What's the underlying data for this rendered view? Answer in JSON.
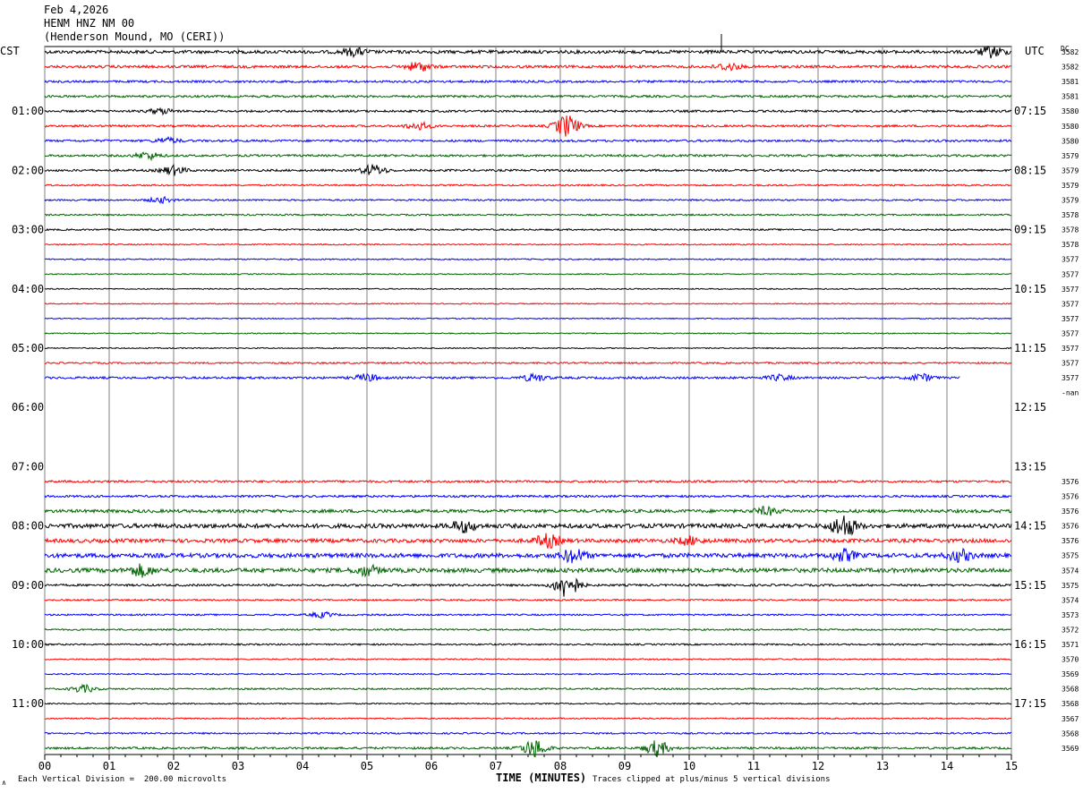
{
  "header": {
    "date": "Feb 4,2026",
    "station": "HENM HNZ NM 00",
    "location": "(Henderson Mound, MO (CERI))"
  },
  "colors": [
    "#000000",
    "#ff0000",
    "#0000ff",
    "#006400"
  ],
  "footer": {
    "scale_note": "Each Vertical Division =  200.00 microvolts",
    "clip_note": "Traces clipped at plus/minus 5 vertical divisions",
    "corner_mark": "∧"
  },
  "chart_data": {
    "type": "line",
    "title": "",
    "xlabel": "TIME (MINUTES)",
    "xlim": [
      0,
      15
    ],
    "x_ticks": [
      "00",
      "01",
      "02",
      "03",
      "04",
      "05",
      "06",
      "07",
      "08",
      "09",
      "10",
      "11",
      "12",
      "13",
      "14",
      "15"
    ],
    "left_axis_label": "CST",
    "right_axis_label": "UTC",
    "dc_label": "DC",
    "left_hour_labels": [
      "01:00",
      "02:00",
      "03:00",
      "04:00",
      "05:00",
      "06:00",
      "07:00",
      "08:00",
      "09:00",
      "10:00",
      "11:00"
    ],
    "right_hour_labels": [
      "07:15",
      "08:15",
      "09:15",
      "10:15",
      "11:15",
      "12:15",
      "13:15",
      "14:15",
      "15:15",
      "16:15",
      "17:15"
    ],
    "gap_label": "-nan",
    "rows": [
      {
        "dc": "3582",
        "amp": 3,
        "events": [
          [
            4.8,
            4
          ],
          [
            14.7,
            6
          ]
        ]
      },
      {
        "dc": "3582",
        "amp": 2.5,
        "events": [
          [
            5.8,
            5
          ],
          [
            10.6,
            4
          ]
        ]
      },
      {
        "dc": "3581",
        "amp": 2,
        "events": []
      },
      {
        "dc": "3581",
        "amp": 2,
        "events": []
      },
      {
        "dc": "3580",
        "amp": 2,
        "events": [
          [
            1.8,
            3
          ]
        ]
      },
      {
        "dc": "3580",
        "amp": 2,
        "events": [
          [
            5.8,
            4
          ],
          [
            8.1,
            12
          ]
        ]
      },
      {
        "dc": "3580",
        "amp": 2,
        "events": [
          [
            1.9,
            3
          ]
        ]
      },
      {
        "dc": "3579",
        "amp": 2,
        "events": [
          [
            1.6,
            4
          ]
        ]
      },
      {
        "dc": "3579",
        "amp": 2,
        "events": [
          [
            2.0,
            5
          ],
          [
            5.1,
            6
          ]
        ]
      },
      {
        "dc": "3579",
        "amp": 1.5,
        "events": []
      },
      {
        "dc": "3579",
        "amp": 1.5,
        "events": [
          [
            1.8,
            3
          ]
        ]
      },
      {
        "dc": "3578",
        "amp": 1.5,
        "events": []
      },
      {
        "dc": "3578",
        "amp": 1.5,
        "events": []
      },
      {
        "dc": "3578",
        "amp": 1.2,
        "events": []
      },
      {
        "dc": "3577",
        "amp": 1.2,
        "events": []
      },
      {
        "dc": "3577",
        "amp": 1,
        "events": []
      },
      {
        "dc": "3577",
        "amp": 1,
        "events": []
      },
      {
        "dc": "3577",
        "amp": 1,
        "events": []
      },
      {
        "dc": "3577",
        "amp": 1,
        "events": []
      },
      {
        "dc": "3577",
        "amp": 1,
        "events": []
      },
      {
        "dc": "3577",
        "amp": 1,
        "events": []
      },
      {
        "dc": "3577",
        "amp": 1.5,
        "events": []
      },
      {
        "dc": "3577",
        "amp": 2,
        "events": [
          [
            5.0,
            4
          ],
          [
            7.6,
            4
          ],
          [
            11.4,
            3
          ],
          [
            13.6,
            4
          ]
        ],
        "end": 14.2
      },
      {
        "dc": "",
        "amp": 0,
        "events": [],
        "gap": true
      },
      {
        "dc": "",
        "amp": 0,
        "events": [],
        "gap": true
      },
      {
        "dc": "",
        "amp": 0,
        "events": [],
        "gap": true
      },
      {
        "dc": "",
        "amp": 0,
        "events": [],
        "gap": true
      },
      {
        "dc": "",
        "amp": 0,
        "events": [],
        "gap": true
      },
      {
        "dc": "",
        "amp": 0,
        "events": [],
        "gap": true
      },
      {
        "dc": "3576",
        "amp": 2,
        "events": []
      },
      {
        "dc": "3576",
        "amp": 2,
        "events": []
      },
      {
        "dc": "3576",
        "amp": 3,
        "events": [
          [
            11.2,
            4
          ]
        ]
      },
      {
        "dc": "3576",
        "amp": 4,
        "events": [
          [
            6.5,
            6
          ],
          [
            12.4,
            12
          ]
        ]
      },
      {
        "dc": "3576",
        "amp": 3.5,
        "events": [
          [
            7.8,
            7
          ],
          [
            10.0,
            4
          ]
        ]
      },
      {
        "dc": "3575",
        "amp": 4,
        "events": [
          [
            8.2,
            7
          ],
          [
            12.4,
            6
          ],
          [
            14.2,
            6
          ]
        ]
      },
      {
        "dc": "3574",
        "amp": 4,
        "events": [
          [
            1.5,
            6
          ],
          [
            5.0,
            5
          ]
        ]
      },
      {
        "dc": "3575",
        "amp": 2,
        "events": [
          [
            8.1,
            14
          ]
        ]
      },
      {
        "dc": "3574",
        "amp": 1.5,
        "events": []
      },
      {
        "dc": "3573",
        "amp": 1.5,
        "events": [
          [
            4.3,
            3
          ]
        ]
      },
      {
        "dc": "3572",
        "amp": 1.5,
        "events": []
      },
      {
        "dc": "3571",
        "amp": 1.5,
        "events": []
      },
      {
        "dc": "3570",
        "amp": 1.2,
        "events": []
      },
      {
        "dc": "3569",
        "amp": 1.2,
        "events": []
      },
      {
        "dc": "3568",
        "amp": 1.5,
        "events": [
          [
            0.6,
            4
          ]
        ]
      },
      {
        "dc": "3568",
        "amp": 1.2,
        "events": []
      },
      {
        "dc": "3567",
        "amp": 1.2,
        "events": []
      },
      {
        "dc": "3568",
        "amp": 1.5,
        "events": []
      },
      {
        "dc": "3569",
        "amp": 2,
        "events": [
          [
            7.6,
            10
          ],
          [
            9.5,
            8
          ]
        ]
      }
    ]
  }
}
